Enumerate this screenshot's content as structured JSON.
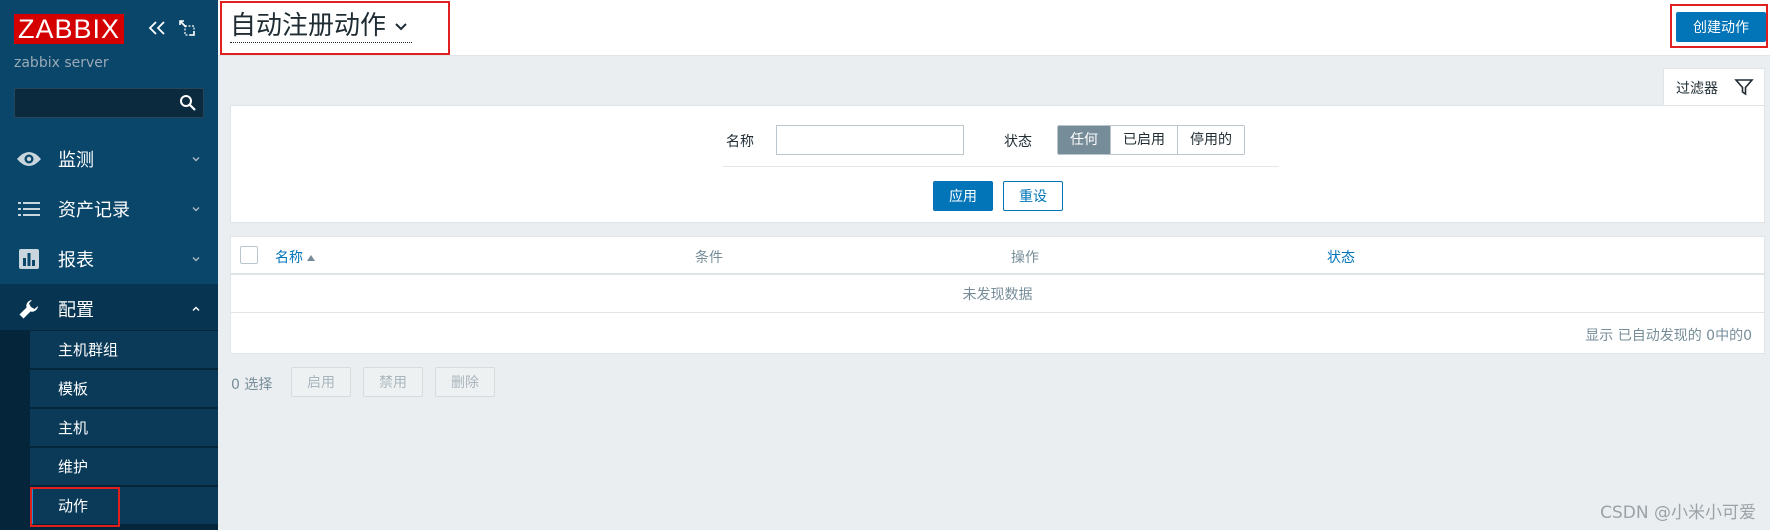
{
  "sidebar": {
    "logo": "ZABBIX",
    "server_name": "zabbix server",
    "search_placeholder": "",
    "menu": [
      {
        "label": "监测",
        "icon": "eye-icon"
      },
      {
        "label": "资产记录",
        "icon": "list-icon"
      },
      {
        "label": "报表",
        "icon": "bar-chart-icon"
      },
      {
        "label": "配置",
        "icon": "wrench-icon"
      }
    ],
    "submenu": [
      {
        "label": "主机群组"
      },
      {
        "label": "模板"
      },
      {
        "label": "主机"
      },
      {
        "label": "维护"
      },
      {
        "label": "动作"
      }
    ]
  },
  "header": {
    "title": "自动注册动作",
    "create_button": "创建动作"
  },
  "filter": {
    "tab_label": "过滤器",
    "name_label": "名称",
    "name_value": "",
    "status_label": "状态",
    "status_options": [
      "任何",
      "已启用",
      "停用的"
    ],
    "status_selected": "任何",
    "apply": "应用",
    "reset": "重设"
  },
  "table": {
    "columns": {
      "name": "名称",
      "conditions": "条件",
      "operations": "操作",
      "status": "状态"
    },
    "empty_text": "未发现数据",
    "footer": "显示 已自动发现的 0中的0"
  },
  "actions": {
    "selected": "0 选择",
    "enable": "启用",
    "disable": "禁用",
    "delete": "删除"
  },
  "watermark": "CSDN @小米小可爱",
  "colors": {
    "sidebar_bg": "#0a466a",
    "accent": "#0275b8",
    "logo_red": "#d40000",
    "highlight_box": "#e01f1f"
  }
}
